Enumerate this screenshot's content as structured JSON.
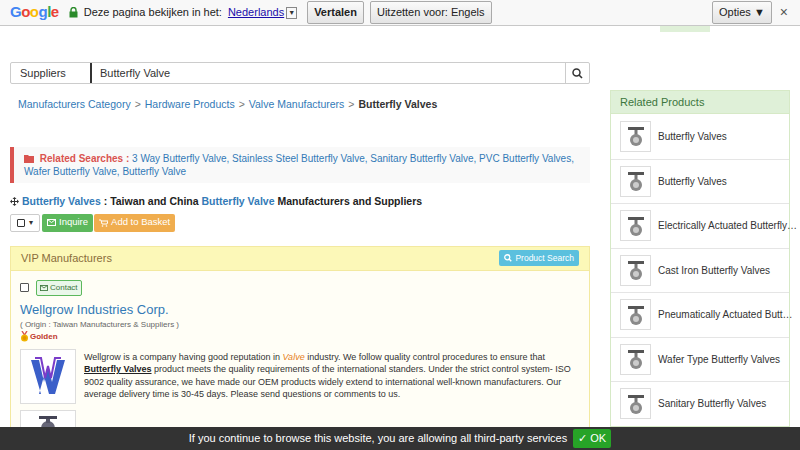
{
  "translate_bar": {
    "logo": "Google",
    "prompt": "Deze pagina bekijken in het:",
    "language": "Nederlands",
    "language_arrow": "▼",
    "translate_button": "Vertalen",
    "off_button": "Uitzetten voor: Engels",
    "options_button": "Opties ▼",
    "close": "×"
  },
  "search": {
    "category": "Suppliers",
    "query": "Butterfly Valve"
  },
  "breadcrumb": {
    "separator": ">",
    "items": [
      {
        "label": "Manufacturers Category",
        "current": false
      },
      {
        "label": "Hardware Products",
        "current": false
      },
      {
        "label": "Valve Manufacturers",
        "current": false
      },
      {
        "label": "Butterfly Valves",
        "current": true
      }
    ]
  },
  "related_searches": {
    "label": "Related Searches :",
    "separator": ",",
    "links": [
      "3 Way Butterfly Valve",
      "Stainless Steel Butterfly Valve",
      "Sanitary Butterfly Valve",
      "PVC Butterfly Valves",
      "Wafer Butterfly Valve",
      "Butterfly Valve"
    ]
  },
  "heading": [
    {
      "text": "Butterfly Valves",
      "kind": "link"
    },
    {
      "text": " : Taiwan and China ",
      "kind": "plain"
    },
    {
      "text": "Butterfly Valve",
      "kind": "link"
    },
    {
      "text": " Manufacturers and Suppliers",
      "kind": "plain"
    }
  ],
  "actions": {
    "select_all_checked": false,
    "caret": "▾",
    "inquire": "Inquire",
    "basket": "Add to Basket"
  },
  "vip": {
    "title": "VIP Manufacturers",
    "search_button": "Product Search",
    "companies": [
      {
        "checked": false,
        "contact": "Contact",
        "name": "Wellgrow Industries Corp.",
        "origin": "( Origin : Taiwan Manufacturers & Suppliers )",
        "badge": "Golden",
        "description": [
          {
            "text": "Wellgrow is a company having good reputation in ",
            "kind": "plain"
          },
          {
            "text": "Valve",
            "kind": "highlight"
          },
          {
            "text": " industry. We follow quality control procedures to ensure that ",
            "kind": "plain"
          },
          {
            "text": "Butterfly Valves",
            "kind": "keyword"
          },
          {
            "text": " product meets the quality requirements of the international standers. Under the strict control system- ISO 9002 quality assurance, we have made our OEM products widely extend to international well-known manufacturers. Our average delivery time is 30-45 days. Please send questions or comments to us.",
            "kind": "plain"
          }
        ]
      }
    ]
  },
  "related_products": {
    "title": "Related Products",
    "items": [
      {
        "label": "Butterfly Valves"
      },
      {
        "label": "Butterfly Valves"
      },
      {
        "label": "Electrically Actuated Butterfly…"
      },
      {
        "label": "Cast Iron Butterfly Valves"
      },
      {
        "label": "Pneumatically Actuated Butt…"
      },
      {
        "label": "Wafer Type Butterfly Valves"
      },
      {
        "label": "Sanitary Butterfly Valves"
      }
    ]
  },
  "cookie": {
    "text": "If you continue to browse this website, you are allowing all third-party services",
    "ok": "✓ OK"
  }
}
